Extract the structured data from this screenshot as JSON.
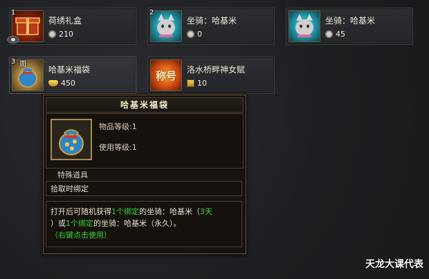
{
  "colors": {
    "accent_green": "#39d53a",
    "tooltip_border": "#6e5a37"
  },
  "items": [
    {
      "badge": "1",
      "name": "荷绣礼盒",
      "currency_icon": "coin-icon",
      "price": "210"
    },
    {
      "badge": "2",
      "name": "坐骑：哈基米",
      "currency_icon": "coin-icon",
      "price": "0"
    },
    {
      "badge": "",
      "name": "坐骑：哈基米",
      "currency_icon": "coin-icon",
      "price": "45"
    },
    {
      "badge": "3",
      "zhou": "周",
      "name": "哈基米福袋",
      "currency_icon": "ingot-icon",
      "price": "450"
    },
    {
      "badge": "",
      "name": "洛水桥畔神女赋",
      "currency_icon": "ticket-icon",
      "price": "10",
      "art_text": "称号"
    }
  ],
  "tooltip": {
    "title": "哈基米福袋",
    "item_level": "物品等级:1",
    "use_level": "使用等级:1",
    "type": "特殊道具",
    "bind": "拾取时绑定",
    "desc": {
      "p1": "打开后可随机获得",
      "n1": "1个",
      "b1": "绑定",
      "p2": "的坐骑：哈基米（",
      "d1": "3天",
      "p3": "）或",
      "n2": "1个",
      "b2": "绑定",
      "p4": "的坐骑：哈基米（永久）。",
      "hint": "（右键点击使用）"
    }
  },
  "watermark": "天龙大课代表"
}
